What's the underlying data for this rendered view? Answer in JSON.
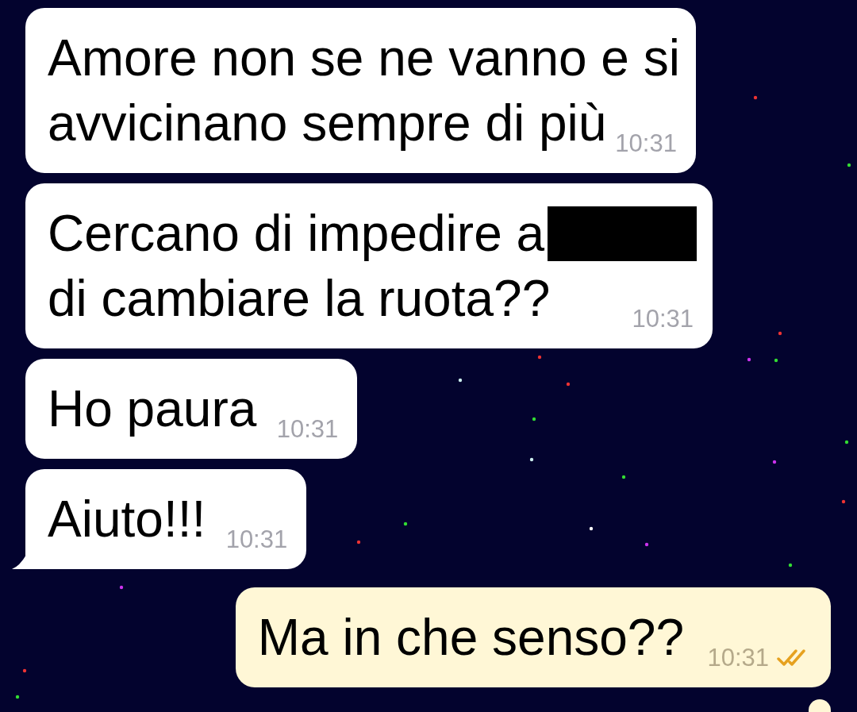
{
  "messages": [
    {
      "kind": "incoming",
      "lines": [
        {
          "text": "Amore non se ne vanno e si"
        },
        {
          "text": "avvicinano sempre di più"
        }
      ],
      "time": "10:31"
    },
    {
      "kind": "incoming",
      "lines": [
        {
          "text": "Cercano di impedire a",
          "redacted": true
        },
        {
          "text": "di cambiare la ruota??"
        }
      ],
      "time": "10:31"
    },
    {
      "kind": "incoming",
      "lines": [
        {
          "text": "Ho paura"
        }
      ],
      "time": "10:31"
    },
    {
      "kind": "incoming",
      "lines": [
        {
          "text": "Aiuto!!!"
        }
      ],
      "time": "10:31",
      "tail": true
    },
    {
      "kind": "outgoing",
      "lines": [
        {
          "text": "Ma in che senso??"
        }
      ],
      "time": "10:31",
      "read": true
    },
    {
      "kind": "outgoing"
    }
  ]
}
